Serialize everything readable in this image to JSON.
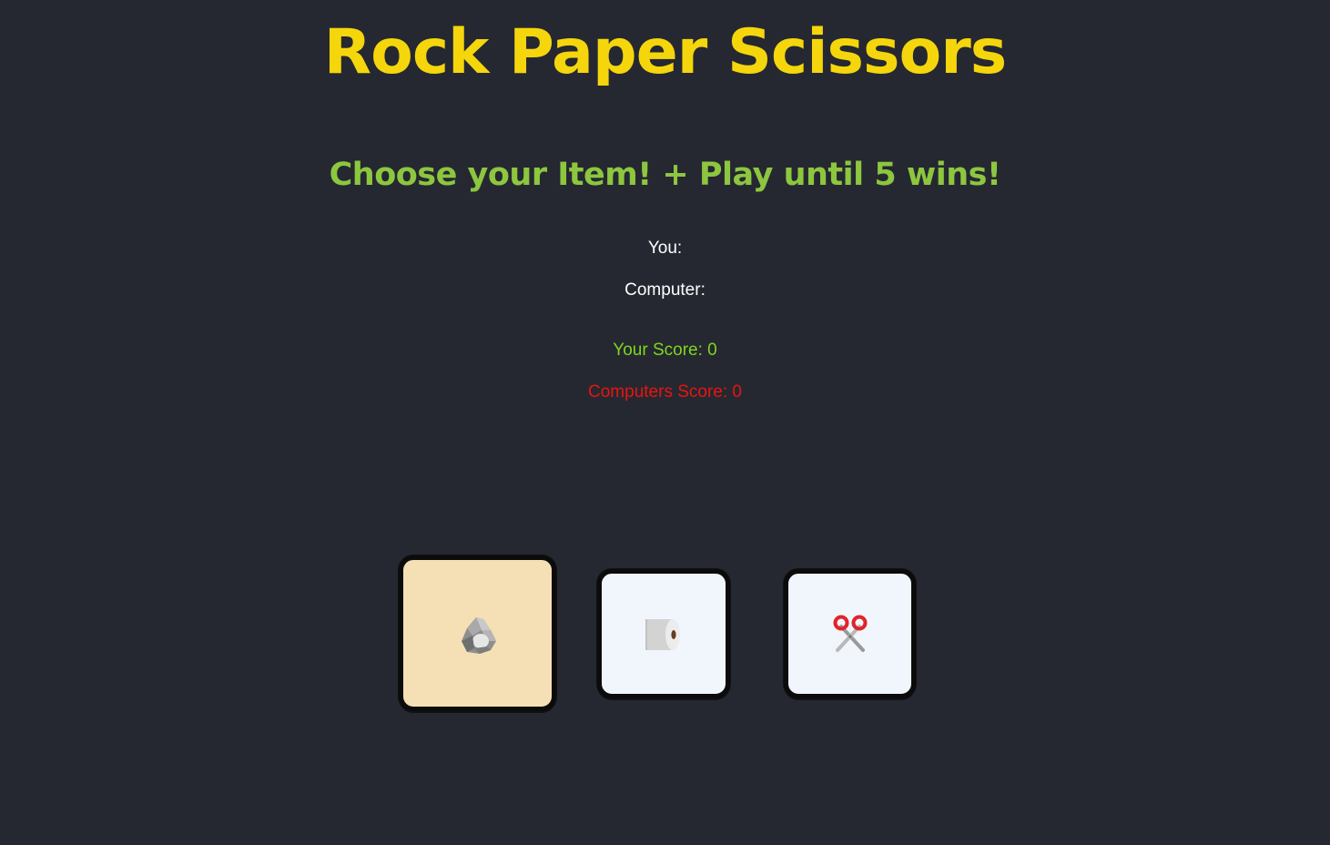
{
  "header": {
    "title": "Rock Paper Scissors",
    "subtitle": "Choose your Item! + Play until 5 wins!"
  },
  "status": {
    "you_label": "You:",
    "computer_label": "Computer:"
  },
  "scores": {
    "your_score_text": "Your Score: 0",
    "computer_score_text": "Computers Score: 0",
    "your_score_color": "#7fd61e",
    "computer_score_color": "#e8150f"
  },
  "choices": [
    {
      "id": "rock",
      "icon": "rock-icon",
      "background": "#f5e0b5",
      "selected": true
    },
    {
      "id": "paper",
      "icon": "toilet-paper-icon",
      "background": "#f1f6fc",
      "selected": false
    },
    {
      "id": "scissors",
      "icon": "scissors-icon",
      "background": "#f1f6fc",
      "selected": false
    }
  ],
  "colors": {
    "page_background": "#252831",
    "title": "#f5d60c",
    "subtitle": "#8dc63f"
  }
}
